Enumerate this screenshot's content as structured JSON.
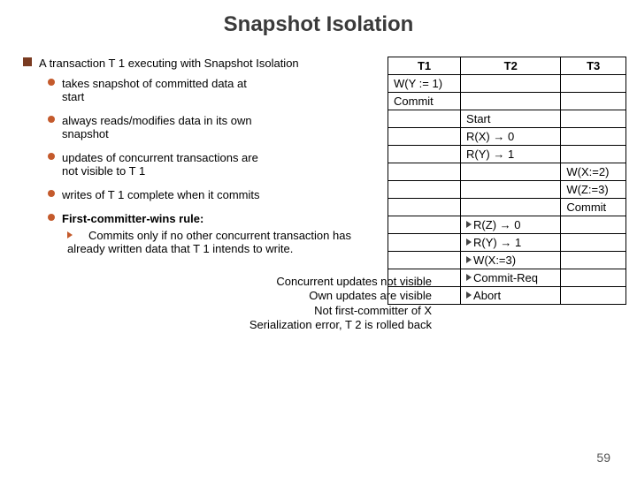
{
  "title": "Snapshot Isolation",
  "main_bullet": "A transaction T 1 executing with Snapshot Isolation",
  "subs": [
    {
      "line1": "takes snapshot of committed data at",
      "line2": "start"
    },
    {
      "line1": "always reads/modifies data in its own",
      "line2": "snapshot"
    },
    {
      "line1": "updates of concurrent transactions are",
      "line2": "not visible to T 1"
    },
    {
      "line1": "writes of T 1 complete when it commits",
      "line2": ""
    },
    {
      "line1": "First-committer-wins rule:",
      "line2": ""
    }
  ],
  "nested": "Commits only if no other concurrent transaction has already written data that T 1 intends to write.",
  "callouts": [
    "Concurrent updates not visible",
    "Own updates are visible",
    "Not first-committer of X",
    "Serialization error, T 2 is rolled back"
  ],
  "table": {
    "headers": [
      "T1",
      "T2",
      "T3"
    ],
    "rows": [
      [
        "W(Y := 1)",
        "",
        ""
      ],
      [
        "Commit",
        "",
        ""
      ],
      [
        "",
        "Start",
        ""
      ],
      [
        "",
        "R(X) → 0",
        ""
      ],
      [
        "",
        "R(Y) → 1",
        ""
      ],
      [
        "",
        "",
        "W(X:=2)"
      ],
      [
        "",
        "",
        "W(Z:=3)"
      ],
      [
        "",
        "",
        "Commit"
      ],
      [
        "",
        "R(Z) → 0",
        ""
      ],
      [
        "",
        "R(Y) → 1",
        ""
      ],
      [
        "",
        "W(X:=3)",
        ""
      ],
      [
        "",
        "Commit-Req",
        ""
      ],
      [
        "",
        "Abort",
        ""
      ]
    ]
  },
  "pagenum": "59"
}
